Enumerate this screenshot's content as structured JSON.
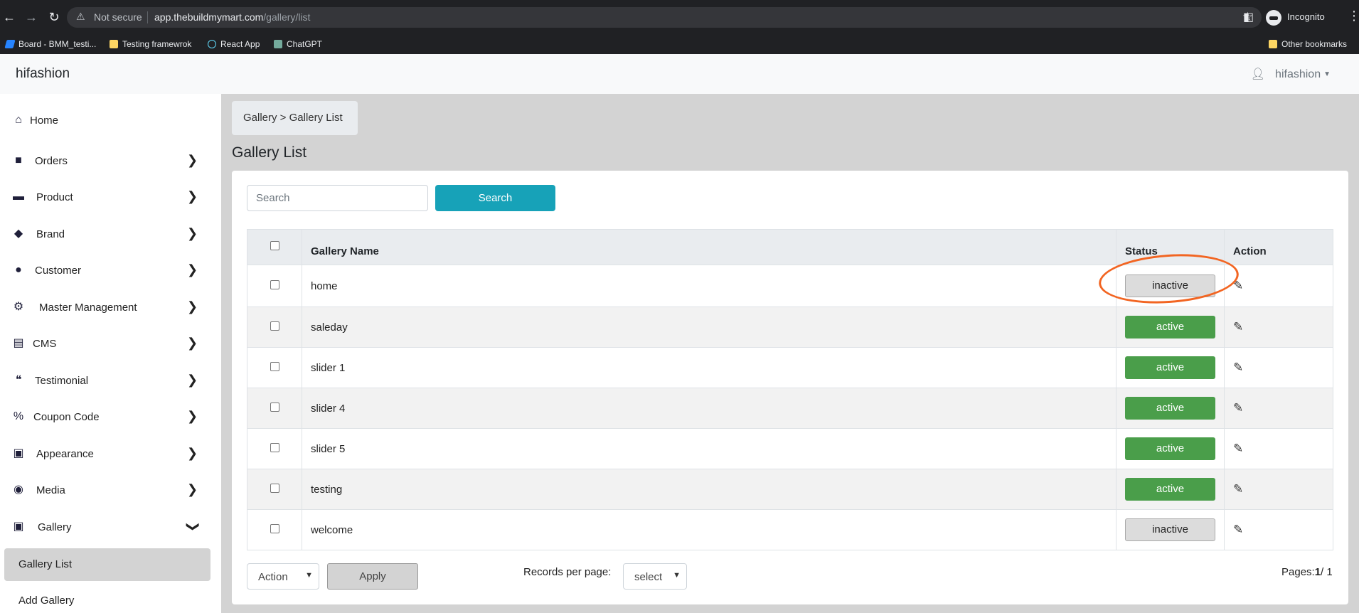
{
  "browser": {
    "back": "←",
    "forward": "→",
    "reload": "↻",
    "not_secure": "Not secure",
    "url_host": "app.thebuildmymart.com",
    "url_path": "/gallery/list",
    "incognito": "Incognito",
    "bookmarks": [
      {
        "label": "Board - BMM_testi...",
        "icon": "jira-board-icon"
      },
      {
        "label": "Testing framewrok",
        "icon": "folder-icon"
      },
      {
        "label": "React App",
        "icon": "react-icon"
      },
      {
        "label": "ChatGPT",
        "icon": "chatgpt-icon"
      }
    ],
    "other_bookmarks": "Other bookmarks"
  },
  "header": {
    "brand": "hifashion",
    "user": "hifashion"
  },
  "sidebar": {
    "items": [
      {
        "label": "Home",
        "icon": "home-icon"
      },
      {
        "label": "Orders",
        "icon": "shopping-bag-icon"
      },
      {
        "label": "Product",
        "icon": "archive-icon"
      },
      {
        "label": "Brand",
        "icon": "tags-icon"
      },
      {
        "label": "Customer",
        "icon": "user-icon"
      },
      {
        "label": "Master Management",
        "icon": "user-gear-icon"
      },
      {
        "label": "CMS",
        "icon": "file-icon"
      },
      {
        "label": "Testimonial",
        "icon": "quote-icon"
      },
      {
        "label": "Coupon Code",
        "icon": "percent-icon"
      },
      {
        "label": "Appearance",
        "icon": "image-icon"
      },
      {
        "label": "Media",
        "icon": "play-circle-icon"
      },
      {
        "label": "Gallery",
        "icon": "images-icon"
      }
    ],
    "gallery_sub": [
      {
        "label": "Gallery List",
        "active": true
      },
      {
        "label": "Add Gallery",
        "active": false
      }
    ]
  },
  "breadcrumb": "Gallery > Gallery List",
  "page_title": "Gallery List",
  "search": {
    "placeholder": "Search",
    "button": "Search"
  },
  "table": {
    "headers": {
      "name": "Gallery Name",
      "status": "Status",
      "action": "Action"
    },
    "rows": [
      {
        "name": "home",
        "status": "inactive"
      },
      {
        "name": "saleday",
        "status": "active"
      },
      {
        "name": "slider 1",
        "status": "active"
      },
      {
        "name": "slider 4",
        "status": "active"
      },
      {
        "name": "slider 5",
        "status": "active"
      },
      {
        "name": "testing",
        "status": "active"
      },
      {
        "name": "welcome",
        "status": "inactive"
      }
    ]
  },
  "footer": {
    "action_select": "Action",
    "apply": "Apply",
    "records_label": "Records per page:",
    "per_page_select": "select",
    "pages_label": "Pages:",
    "page_current": "1",
    "page_total": "/ 1"
  },
  "colors": {
    "active_badge": "#4a9e4a",
    "search_button": "#17a2b8",
    "annotation": "#f26522"
  }
}
